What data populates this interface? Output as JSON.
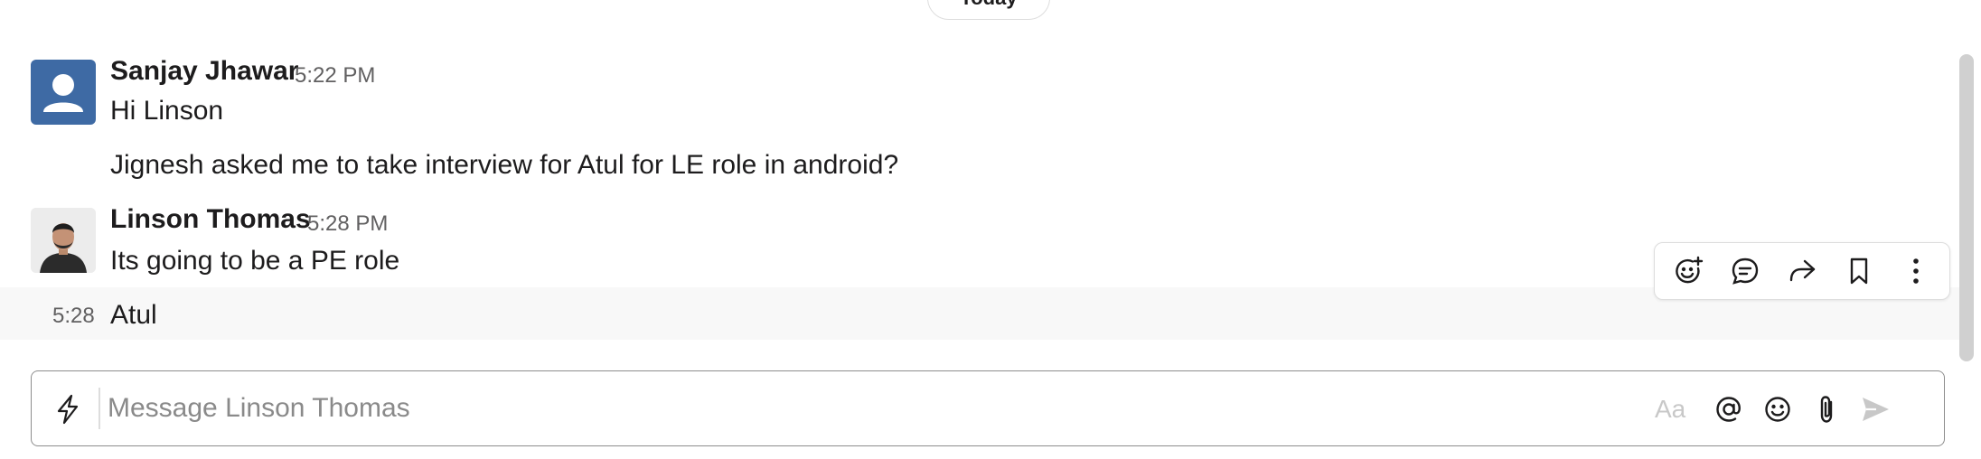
{
  "divider": {
    "label": "Today"
  },
  "messages": [
    {
      "author": "Sanjay Jhawar",
      "time": "5:22 PM",
      "lines": [
        "Hi Linson",
        "Jignesh asked me to take interview for Atul for LE role in android?"
      ]
    },
    {
      "author": "Linson Thomas",
      "time": "5:28 PM",
      "lines": [
        "Its going to be a PE role"
      ]
    }
  ],
  "followup": {
    "time": "5:28",
    "text": "Atul"
  },
  "message_actions": [
    "add-reaction-icon",
    "reply-in-thread-icon",
    "forward-icon",
    "bookmark-icon",
    "more-actions-icon"
  ],
  "composer": {
    "placeholder": "Message Linson Thomas",
    "value": "",
    "format_label": "Aa"
  },
  "colors": {
    "avatar_bg": "#3e6aa4",
    "text": "#1d1c1d",
    "muted": "#616061",
    "hover_bg": "#f8f8f8"
  }
}
